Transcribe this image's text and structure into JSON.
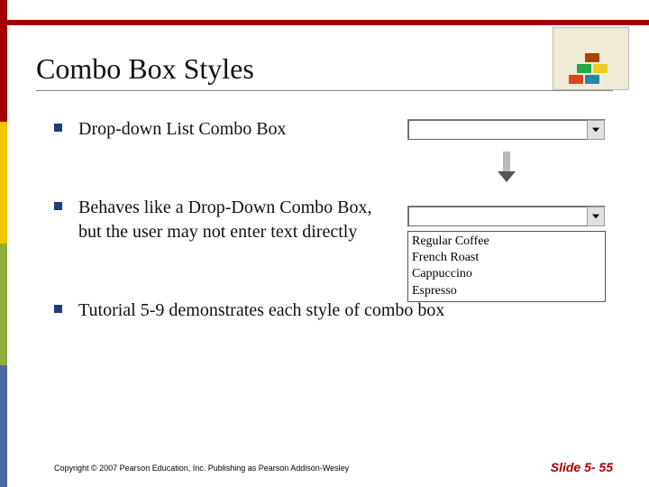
{
  "title": "Combo Box Styles",
  "bullets": [
    "Drop-down List Combo Box",
    "Behaves like a Drop-Down Combo Box, but the user may not enter text directly",
    "Tutorial 5-9 demonstrates each style of combo box"
  ],
  "combo": {
    "options": [
      "Regular Coffee",
      "French Roast",
      "Cappuccino",
      "Espresso"
    ]
  },
  "footer": {
    "copyright": "Copyright © 2007 Pearson Education, Inc. Publishing as Pearson Addison-Wesley",
    "slide": "Slide 5- 55"
  }
}
